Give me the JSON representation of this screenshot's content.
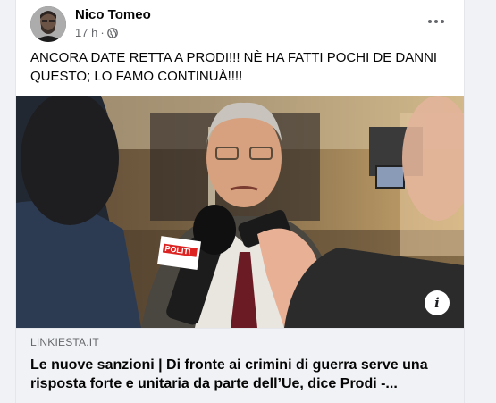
{
  "post": {
    "author": "Nico Tomeo",
    "time": "17 h",
    "separator": "·",
    "privacy_icon": "globe-icon",
    "text": "ANCORA DATE RETTA A PRODI!!! NÈ HA FATTI POCHI DE DANNI QUESTO; LO FAMO CONTINUÀ!!!!",
    "more_icon": "more-options-icon"
  },
  "link": {
    "domain": "LINKIESTA.IT",
    "title": "Le nuove sanzioni | Di fronte ai crimini di guerra serve una risposta forte e unitaria da parte dell’Ue, dice Prodi -...",
    "info_icon_glyph": "i"
  },
  "media": {
    "mic_brand": "POLITI"
  },
  "colors": {
    "background": "#f0f2f5",
    "card": "#ffffff",
    "secondary_text": "#65676b"
  }
}
